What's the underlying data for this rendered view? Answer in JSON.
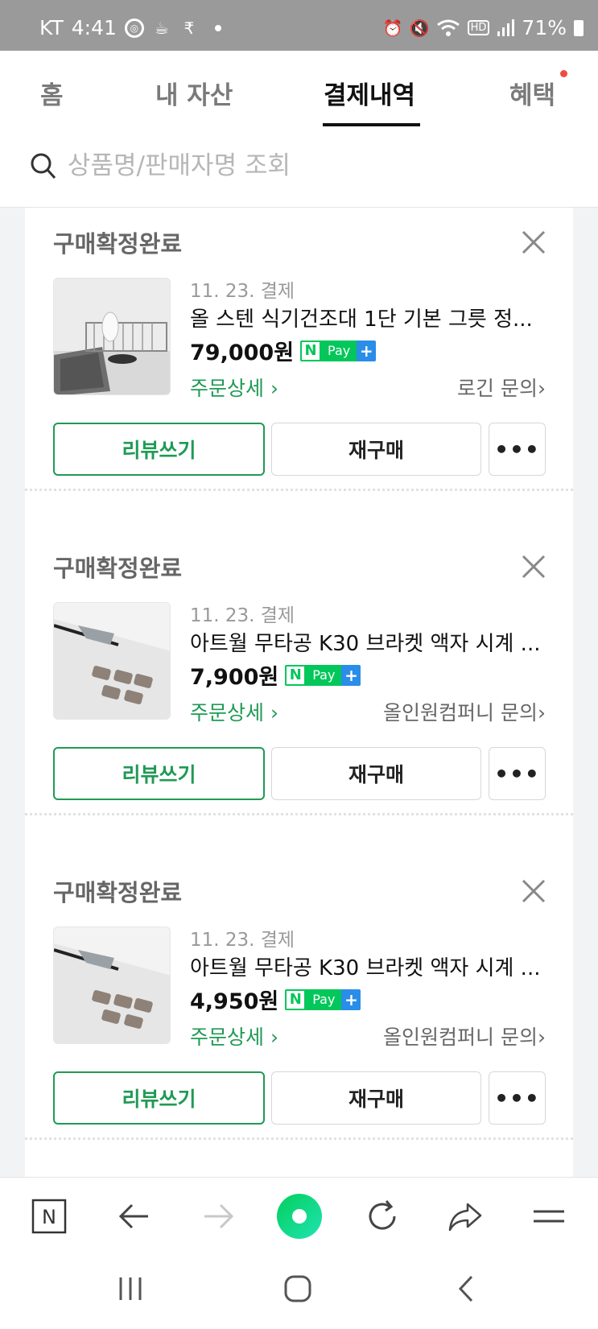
{
  "status_bar": {
    "carrier": "KT",
    "time": "4:41",
    "battery": "71%",
    "hd": "HD"
  },
  "tabs": [
    {
      "label": "홈"
    },
    {
      "label": "내 자산"
    },
    {
      "label": "결제내역"
    },
    {
      "label": "혜택"
    }
  ],
  "search": {
    "placeholder": "상품명/판매자명 조회"
  },
  "orders": [
    {
      "status": "구매확정완료",
      "date": "11. 23. 결제",
      "title": "올 스텐 식기건조대 1단 기본 그릇 정...",
      "price": "79,000원",
      "detail_link": "주문상세",
      "seller": "로긴 문의",
      "review_label": "리뷰쓰기",
      "rebuy_label": "재구매",
      "more_label": "•••"
    },
    {
      "status": "구매확정완료",
      "date": "11. 23. 결제",
      "title": "아트월 무타공 K30 브라켓 액자 시계 ...",
      "price": "7,900원",
      "detail_link": "주문상세",
      "seller": "올인원컴퍼니 문의",
      "review_label": "리뷰쓰기",
      "rebuy_label": "재구매",
      "more_label": "•••"
    },
    {
      "status": "구매확정완료",
      "date": "11. 23. 결제",
      "title": "아트월 무타공 K30 브라켓 액자 시계 ...",
      "price": "4,950원",
      "detail_link": "주문상세",
      "seller": "올인원컴퍼니 문의",
      "review_label": "리뷰쓰기",
      "rebuy_label": "재구매",
      "more_label": "•••"
    }
  ],
  "npay": {
    "n": "N",
    "pay": "Pay",
    "plus": "+"
  },
  "colors": {
    "accent_green": "#1f9a55",
    "npay_green": "#03c75a",
    "npay_blue": "#2a8de8",
    "notification_dot": "#f04d3f",
    "browser_icon_gradient": "#20e3b2"
  }
}
